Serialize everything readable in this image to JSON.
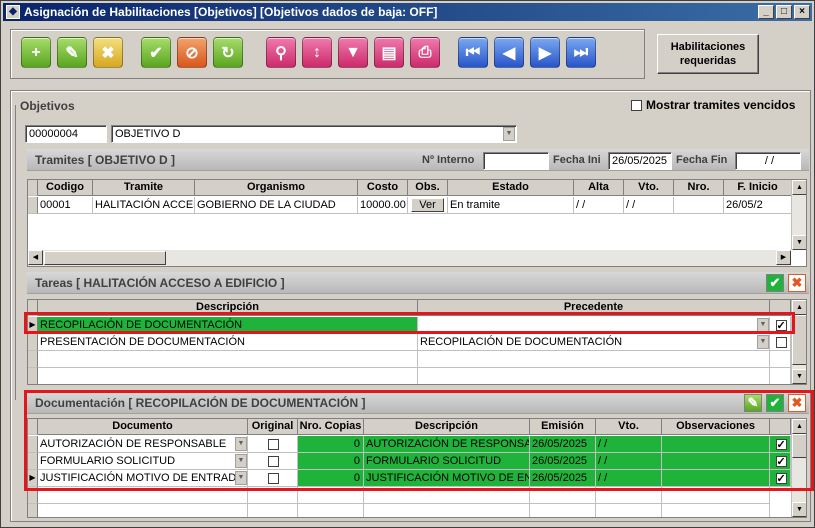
{
  "window": {
    "title": "Asignación de Habilitaciones [Objetivos] [Objetivos dados de baja: OFF]"
  },
  "toolbar": {
    "buttons": [
      {
        "name": "add-button",
        "icon": "plus-icon",
        "glyph": "+",
        "color": "g"
      },
      {
        "name": "edit-button",
        "icon": "pencil-icon",
        "glyph": "✎",
        "color": "g"
      },
      {
        "name": "delete-button",
        "icon": "delete-doc-icon",
        "glyph": "✖",
        "color": "y"
      },
      {
        "name": "accept-button",
        "icon": "check-icon",
        "glyph": "✔",
        "color": "g"
      },
      {
        "name": "cancel-button",
        "icon": "cancel-icon",
        "glyph": "⊘",
        "color": "o"
      },
      {
        "name": "refresh-button",
        "icon": "refresh-icon",
        "glyph": "↻",
        "color": "g"
      },
      {
        "name": "search-button",
        "icon": "search-icon",
        "glyph": "⚲",
        "color": "p"
      },
      {
        "name": "sort-button",
        "icon": "sort-az-icon",
        "glyph": "↕",
        "color": "p"
      },
      {
        "name": "filter-button",
        "icon": "filter-icon",
        "glyph": "▼",
        "color": "p"
      },
      {
        "name": "report-button",
        "icon": "clipboard-icon",
        "glyph": "▤",
        "color": "p"
      },
      {
        "name": "print-button",
        "icon": "printer-icon",
        "glyph": "⎙",
        "color": "p"
      },
      {
        "name": "first-button",
        "icon": "first-icon",
        "glyph": "⏮",
        "color": "b"
      },
      {
        "name": "prev-button",
        "icon": "prev-icon",
        "glyph": "◀",
        "color": "b"
      },
      {
        "name": "next-button",
        "icon": "next-icon",
        "glyph": "▶",
        "color": "b"
      },
      {
        "name": "last-button",
        "icon": "last-icon",
        "glyph": "⏭",
        "color": "b"
      }
    ],
    "req_label_1": "Habilitaciones",
    "req_label_2": "requeridas"
  },
  "objetivos": {
    "title": "Objetivos",
    "show_expired_label": "Mostrar tramites vencidos",
    "show_expired": false,
    "code": "00000004",
    "name": "OBJETIVO D"
  },
  "tramites": {
    "title": "Tramites [ OBJETIVO D ]",
    "nro_interno_label": "Nº Interno",
    "nro_interno": "",
    "fecha_ini_label": "Fecha Ini",
    "fecha_ini": "26/05/2025",
    "fecha_fin_label": "Fecha Fin",
    "fecha_fin": " / /",
    "columns": [
      "Codigo",
      "Tramite",
      "Organismo",
      "Costo",
      "Obs.",
      "Estado",
      "Alta",
      "Vto.",
      "Nro.",
      "F. Inicio"
    ],
    "rows": [
      [
        "00001",
        "HALITACIÓN ACCESO A",
        "GOBIERNO DE LA CIUDAD",
        "10000.00",
        "Ver",
        "En tramite",
        "/ /",
        "/ /",
        "",
        "26/05/2"
      ]
    ]
  },
  "tareas": {
    "title": "Tareas [ HALITACIÓN ACCESO A EDIFICIO ]",
    "columns": [
      "Descripción",
      "Precedente"
    ],
    "rows": [
      {
        "desc": "RECOPILACIÓN DE DOCUMENTACIÓN",
        "prec": "",
        "checked": true
      },
      {
        "desc": "PRESENTACIÓN DE DOCUMENTACIÓN",
        "prec": "RECOPILACIÓN DE DOCUMENTACIÓN",
        "checked": false
      }
    ]
  },
  "documentacion": {
    "title": "Documentación [ RECOPILACIÓN DE DOCUMENTACIÓN ]",
    "columns": [
      "Documento",
      "Original",
      "Nro. Copias",
      "Descripción",
      "Emisión",
      "Vto.",
      "Observaciones"
    ],
    "rows": [
      {
        "doc": "AUTORIZACIÓN DE RESPONSABLE",
        "copias": "0",
        "desc": "AUTORIZACIÓN DE RESPONSABL",
        "emision": "26/05/2025",
        "vto": "/ /",
        "obs": "",
        "checked": true
      },
      {
        "doc": "FORMULARIO SOLICITUD",
        "copias": "0",
        "desc": "FORMULARIO SOLICITUD",
        "emision": "26/05/2025",
        "vto": "/ /",
        "obs": "",
        "checked": true
      },
      {
        "doc": "JUSTIFICACIÓN MOTIVO DE ENTRADA",
        "copias": "0",
        "desc": "JUSTIFICACIÓN MOTIVO DE ENTR",
        "emision": "26/05/2025",
        "vto": "/ /",
        "obs": "",
        "checked": true
      }
    ]
  },
  "colors": {
    "highlight": "#1fb33c",
    "annotation": "#e4151b",
    "titlebar": "#0a246a"
  }
}
